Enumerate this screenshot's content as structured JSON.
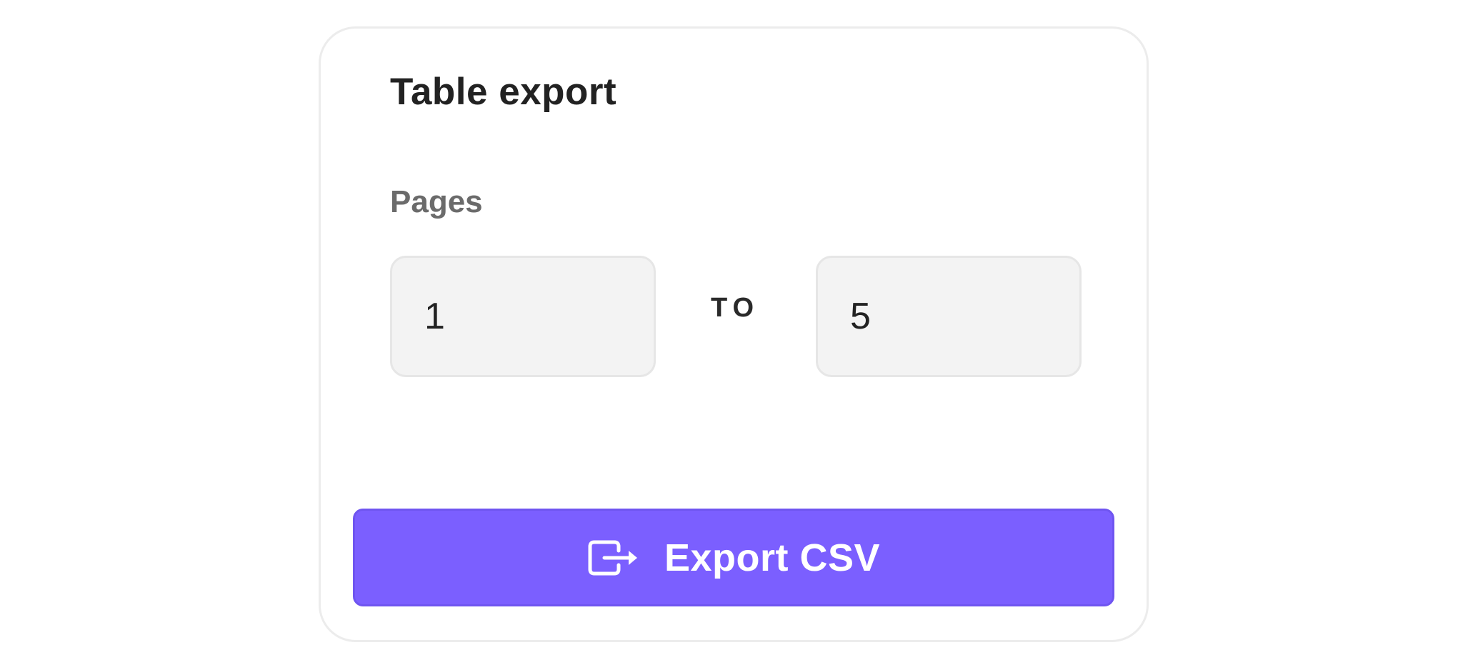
{
  "card": {
    "title": "Table export",
    "pages_label": "Pages",
    "range": {
      "from_value": "1",
      "separator": "TO",
      "to_value": "5"
    },
    "export_button": {
      "label": "Export CSV",
      "icon": "export-icon"
    }
  },
  "colors": {
    "accent": "#7b5fff",
    "field_background": "#f3f3f3",
    "card_border": "#ececec",
    "title_text": "#222222",
    "label_text": "#6b6b6b"
  }
}
